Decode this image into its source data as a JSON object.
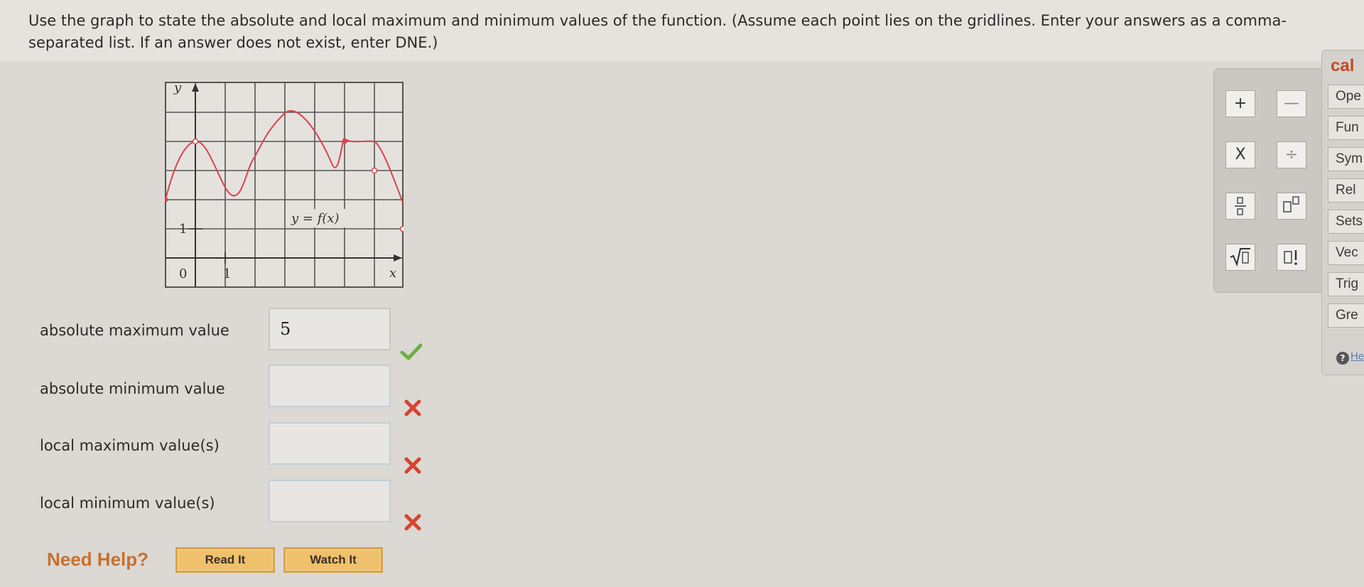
{
  "prompt": "Use the graph to state the absolute and local maximum and minimum values of the function. (Assume each point lies on the gridlines. Enter your answers as a comma-separated list. If an answer does not exist, enter DNE.)",
  "graph": {
    "y_axis_label": "y",
    "x_axis_label": "x",
    "origin_label": "0",
    "x_tick_label": "1",
    "y_tick_label": "1",
    "function_label": "y = f(x)",
    "curve_color": "#d9434f"
  },
  "answers": [
    {
      "label": "absolute maximum value",
      "value": "5",
      "status": "correct"
    },
    {
      "label": "absolute minimum value",
      "value": "",
      "status": "incorrect"
    },
    {
      "label": "local maximum value(s)",
      "value": "",
      "status": "incorrect"
    },
    {
      "label": "local minimum value(s)",
      "value": "",
      "status": "incorrect"
    }
  ],
  "help": {
    "label": "Need Help?",
    "read_button": "Read It",
    "watch_button": "Watch It"
  },
  "calculator": {
    "keys": [
      "+",
      "—",
      "X",
      "÷",
      "fraction-icon",
      "power-icon",
      "sqrt-icon",
      "factorial-icon"
    ]
  },
  "side_panel": {
    "title": "cal",
    "tabs": [
      "Ope",
      "Fun",
      "Sym",
      "Rel",
      "Sets",
      "Vec",
      "Trig",
      "Gre"
    ],
    "help_text": "He"
  },
  "colors": {
    "correct": "#6fae45",
    "incorrect": "#d8432f",
    "need_help": "#c8702c",
    "button_bg": "#efc16c"
  }
}
